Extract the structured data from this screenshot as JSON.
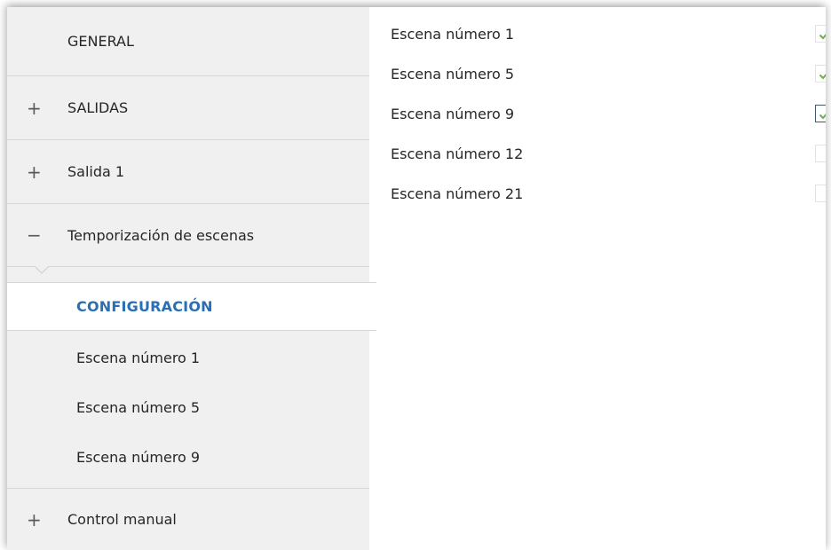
{
  "sidebar": {
    "items": [
      {
        "label": "GENERAL",
        "sign": ""
      },
      {
        "label": "SALIDAS",
        "sign": "+"
      },
      {
        "label": "Salida 1",
        "sign": "+"
      },
      {
        "label": "Temporización de escenas",
        "sign": "−"
      }
    ],
    "sub_items": [
      {
        "label": "CONFIGURACIÓN",
        "active": true
      },
      {
        "label": "Escena número 1"
      },
      {
        "label": "Escena número 5"
      },
      {
        "label": "Escena número 9"
      }
    ],
    "bottom_item": {
      "label": "Control manual",
      "sign": "+"
    }
  },
  "scenes": [
    {
      "label": "Escena número 1",
      "checked": true
    },
    {
      "label": "Escena número 5",
      "checked": true
    },
    {
      "label": "Escena número 9",
      "checked": true,
      "focused": true
    },
    {
      "label": "Escena número 12",
      "checked": false
    },
    {
      "label": "Escena número 21",
      "checked": false
    }
  ],
  "colors": {
    "accent": "#2a6fb3",
    "check": "#6fae4a",
    "sidebar_bg": "#f0f0f0"
  }
}
